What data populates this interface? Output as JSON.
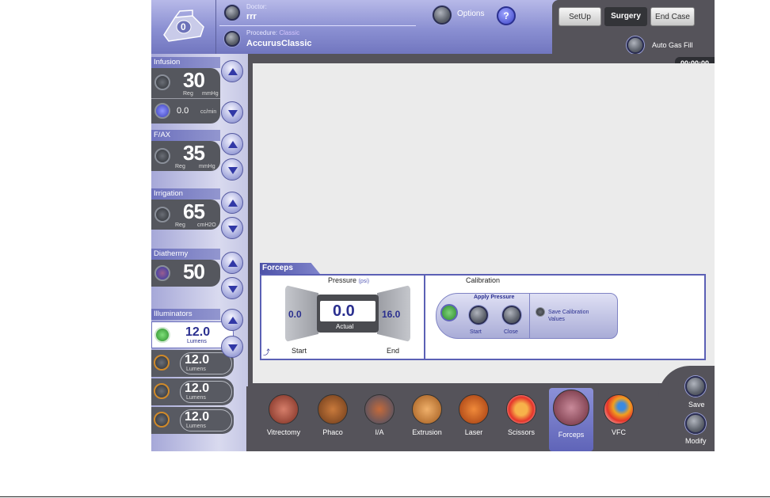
{
  "header": {
    "cassette_count": "0",
    "doctor_label": "Doctor:",
    "doctor_value": "rrr",
    "procedure_label": "Procedure:",
    "procedure_version": "Classic",
    "procedure_value": "AccurusClassic",
    "options_label": "Options",
    "help_label": "?",
    "tabs": {
      "setup": "SetUp",
      "surgery": "Surgery",
      "endcase": "End Case"
    },
    "auto_gas_label": "Auto Gas Fill",
    "timer": "00:00:00"
  },
  "left": {
    "infusion": {
      "title": "Infusion",
      "value": "30",
      "mode": "Reg",
      "unit": "mmHg",
      "flow_value": "0.0",
      "flow_unit": "cc/min"
    },
    "fax": {
      "title": "F/AX",
      "value": "35",
      "mode": "Reg",
      "unit": "mmHg"
    },
    "irrigation": {
      "title": "Irrigation",
      "value": "65",
      "mode": "Reg",
      "unit": "cmH2O"
    },
    "diathermy": {
      "title": "Diathermy",
      "value": "50"
    },
    "illuminators": {
      "title": "Illuminators",
      "items": [
        {
          "value": "12.0",
          "unit": "Lumens"
        },
        {
          "value": "12.0",
          "unit": "Lumens"
        },
        {
          "value": "12.0",
          "unit": "Lumens"
        },
        {
          "value": "12.0",
          "unit": "Lumens"
        }
      ]
    }
  },
  "forceps": {
    "title": "Forceps",
    "pressure_label": "Pressure",
    "pressure_unit": "(psi)",
    "start_value": "0.0",
    "actual_value": "0.0",
    "actual_label": "Actual",
    "end_value": "16.0",
    "start_label": "Start",
    "end_label": "End",
    "calibration_label": "Calibration",
    "apply_pressure_label": "Apply Pressure",
    "cal_start_label": "Start",
    "cal_close_label": "Close",
    "save_cal_label": "Save Calibration Values"
  },
  "tools": [
    "Vitrectomy",
    "Phaco",
    "I/A",
    "Extrusion",
    "Laser",
    "Scissors",
    "Forceps",
    "VFC"
  ],
  "side": {
    "save_label": "Save",
    "modify_label": "Modify"
  },
  "colors": {
    "accent": "#7176bf",
    "panel": "#55535a"
  }
}
